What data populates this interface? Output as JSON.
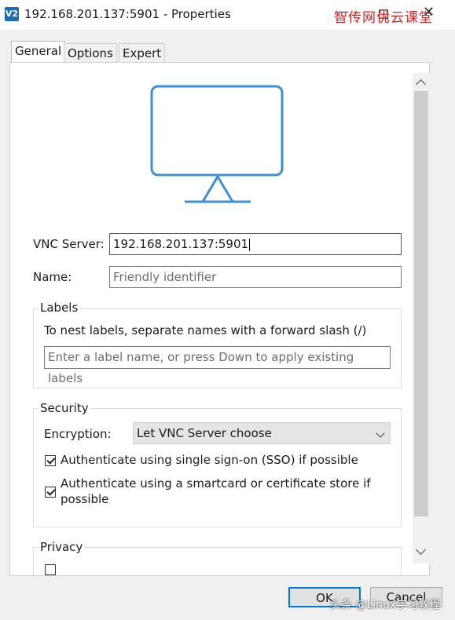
{
  "window": {
    "title": "192.168.201.137:5901 - Properties",
    "app_icon_text": "V2",
    "watermark_top": "智传网优云课堂",
    "close_symbol": "✕",
    "minimize_symbol": "—",
    "maximize_symbol": "口"
  },
  "tabs": [
    {
      "label": "General",
      "active": true
    },
    {
      "label": "Options",
      "active": false
    },
    {
      "label": "Expert",
      "active": false
    }
  ],
  "general": {
    "vnc_server_label": "VNC Server:",
    "vnc_server_value": "192.168.201.137:5901",
    "name_label": "Name:",
    "name_placeholder": "Friendly identifier",
    "labels_group": "Labels",
    "labels_hint": "To nest labels, separate names with a forward slash (/)",
    "labels_placeholder": "Enter a label name, or press Down to apply existing labels",
    "security_group": "Security",
    "encryption_label": "Encryption:",
    "encryption_value": "Let VNC Server choose",
    "sso_label": "Authenticate using single sign-on (SSO) if possible",
    "sso_checked": true,
    "smartcard_label_line1": "Authenticate using a smartcard or certificate store if",
    "smartcard_label_line2": "possible",
    "smartcard_checked": true,
    "privacy_group": "Privacy"
  },
  "buttons": {
    "ok": "OK",
    "cancel": "Cancel"
  },
  "watermark_bottom": "头条 @Linux学习教程",
  "colors": {
    "monitor_stroke": "#3d8fd6",
    "watermark_red": "#e02020",
    "primary_border": "#0078d7"
  }
}
